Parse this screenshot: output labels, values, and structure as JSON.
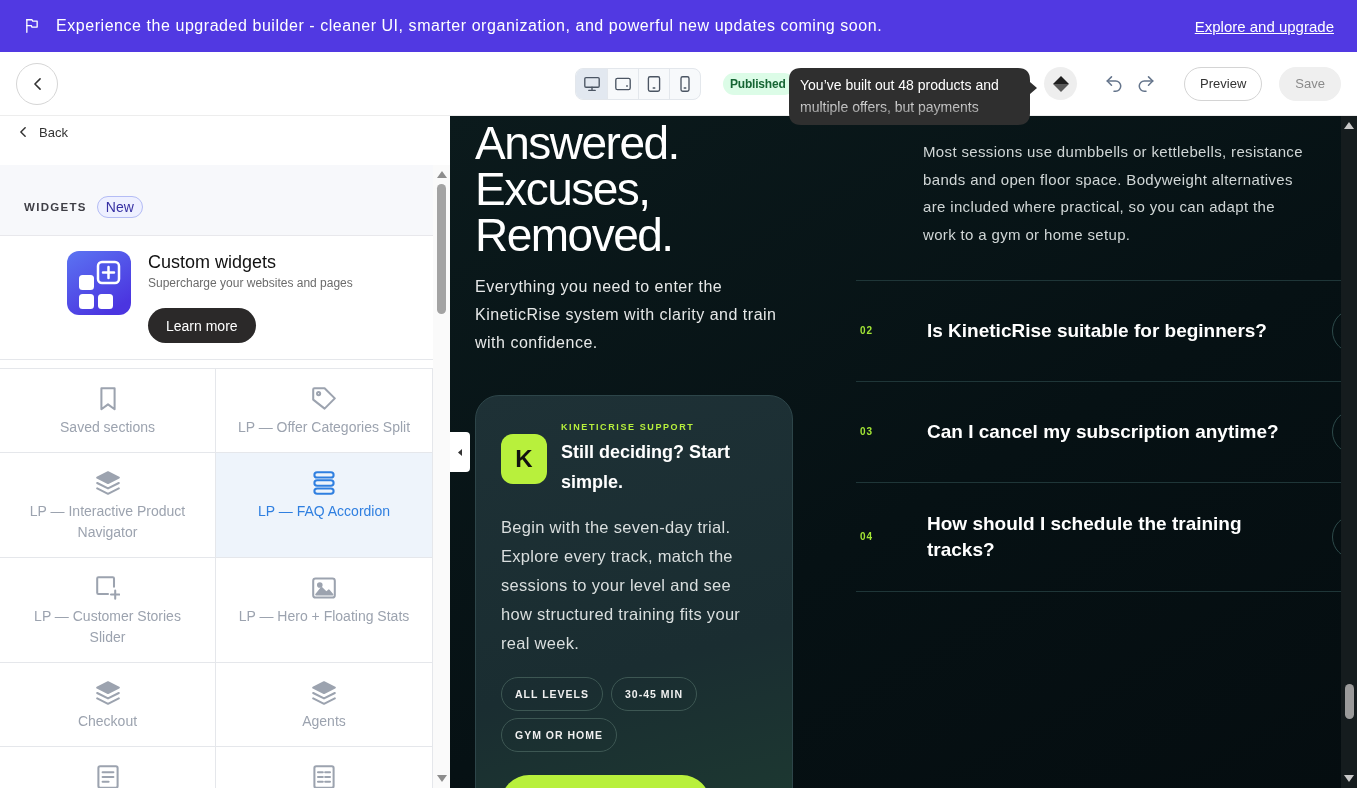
{
  "banner": {
    "message": "Experience the upgraded builder - cleaner UI, smarter organization, and powerful new updates coming soon.",
    "link": "Explore and upgrade"
  },
  "toolbar": {
    "devices": [
      {
        "selected": true
      },
      {
        "selected": false
      },
      {
        "selected": false
      },
      {
        "selected": false
      }
    ],
    "status": "Published",
    "buttons": [
      {
        "label": "Preview",
        "disabled": false
      },
      {
        "label": "Save",
        "disabled": true
      }
    ]
  },
  "tooltip": {
    "text": "You’ve built out 48 products and multiple offers, but payments"
  },
  "sidebar": {
    "back": "Back",
    "section_title": "WIDGETS",
    "badge": "New",
    "promo": {
      "title": "Custom widgets",
      "subtitle": "Supercharge your websites and pages",
      "button": "Learn more"
    },
    "widgets": [
      {
        "label": "Saved sections",
        "selected": false
      },
      {
        "label": "LP — Offer Categories Split",
        "selected": false
      },
      {
        "label": "LP — Interactive Product Navigator",
        "selected": false
      },
      {
        "label": "LP — FAQ Accordion",
        "selected": true
      },
      {
        "label": "LP — Customer Stories Slider",
        "selected": false
      },
      {
        "label": "LP — Hero + Floating Stats",
        "selected": false
      },
      {
        "label": "Checkout",
        "selected": false
      },
      {
        "label": "Agents",
        "selected": false
      },
      {
        "selected": false
      },
      {
        "selected": false
      }
    ]
  },
  "preview": {
    "heading": "Answered. Excuses, Removed.",
    "intro": "Everything you need to enter the KineticRise system with clarity and train with confidence.",
    "card": {
      "eyebrow": "KINETICRISE SUPPORT",
      "avatar": "K",
      "title": "Still deciding? Start simple.",
      "body": "Begin with the seven-day trial. Explore every track, match the sessions to your level and see how structured training fits your real week.",
      "tags": [
        "ALL LEVELS",
        "30-45 MIN",
        "GYM OR HOME"
      ]
    },
    "faq": [
      {
        "answer": "Most sessions use dumbbells or kettlebells, resistance bands and open floor space. Bodyweight alternatives are included where practical, so you can adapt the work to a gym or home setup."
      },
      {
        "number": "02",
        "question": "Is KineticRise suitable for beginners?"
      },
      {
        "number": "03",
        "question": "Can I cancel my subscription anytime?"
      },
      {
        "number": "04",
        "question": "How should I schedule the training tracks?"
      }
    ]
  }
}
